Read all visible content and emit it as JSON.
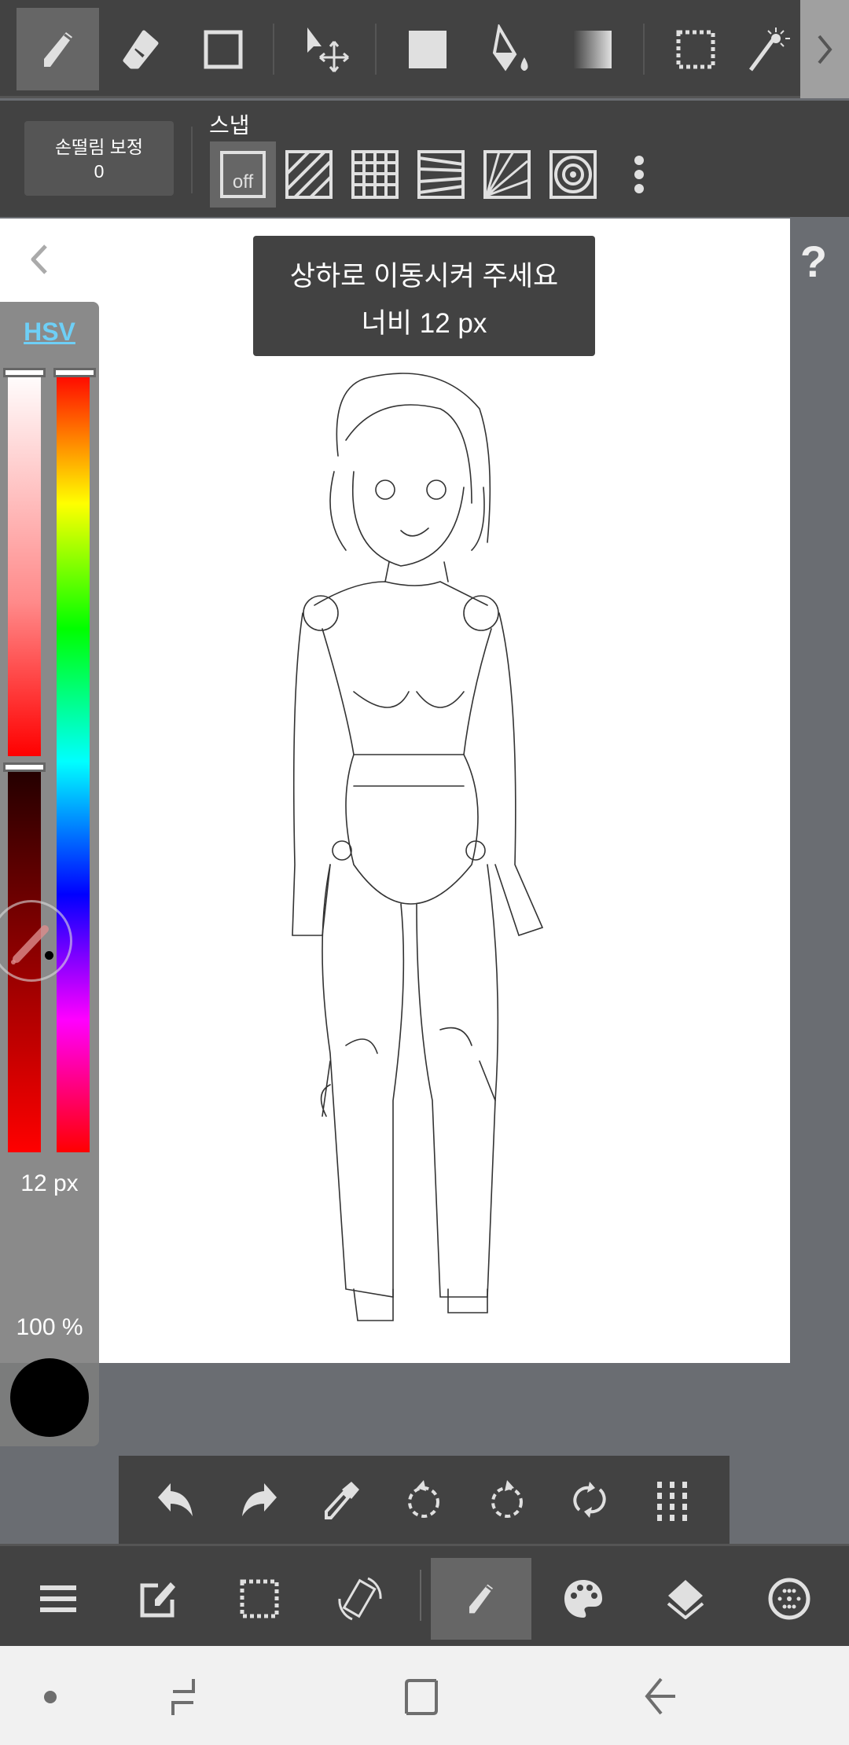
{
  "top_toolbar": {
    "tools": [
      {
        "name": "pen",
        "icon": "pen-icon",
        "active": true
      },
      {
        "name": "eraser",
        "icon": "eraser-icon"
      },
      {
        "name": "shape",
        "icon": "rectangle-outline-icon"
      },
      {
        "name": "move",
        "icon": "move-icon"
      },
      {
        "name": "fill-rect",
        "icon": "filled-rectangle-icon"
      },
      {
        "name": "bucket",
        "icon": "bucket-icon"
      },
      {
        "name": "gradient",
        "icon": "gradient-icon"
      },
      {
        "name": "select",
        "icon": "selection-icon"
      },
      {
        "name": "magic-wand",
        "icon": "magic-wand-icon"
      }
    ],
    "more_icon": "chevron-right-icon"
  },
  "second_toolbar": {
    "stabilizer_label": "손떨림 보정",
    "stabilizer_value": "0",
    "snap_label": "스냅",
    "snap_off_label": "off",
    "snap_options": [
      "off",
      "parallel",
      "grid",
      "perspective",
      "radial",
      "concentric"
    ]
  },
  "tooltip": {
    "line1": "상하로 이동시켜 주세요",
    "line2": "너비 12 px"
  },
  "help_label": "?",
  "color_panel": {
    "mode_label": "HSV",
    "brush_size": "12 px",
    "opacity": "100 %",
    "current_color": "#000000",
    "hue_position": 0,
    "saturation_position": 0,
    "value_position": 0
  },
  "colors": {
    "toolbar": "#424242",
    "active": "#666666",
    "canvas_bg": "#6a6d72",
    "accent": "#6ecff6"
  },
  "bottom_tools": [
    "undo",
    "redo",
    "eyedropper",
    "rotate-left",
    "rotate-right",
    "flip",
    "grid-menu"
  ],
  "bottom_bar": [
    "menu",
    "edit",
    "selection",
    "rotate-canvas",
    "brush",
    "palette",
    "layers",
    "material"
  ],
  "nav_bar": [
    "dot",
    "recent",
    "home",
    "back"
  ]
}
